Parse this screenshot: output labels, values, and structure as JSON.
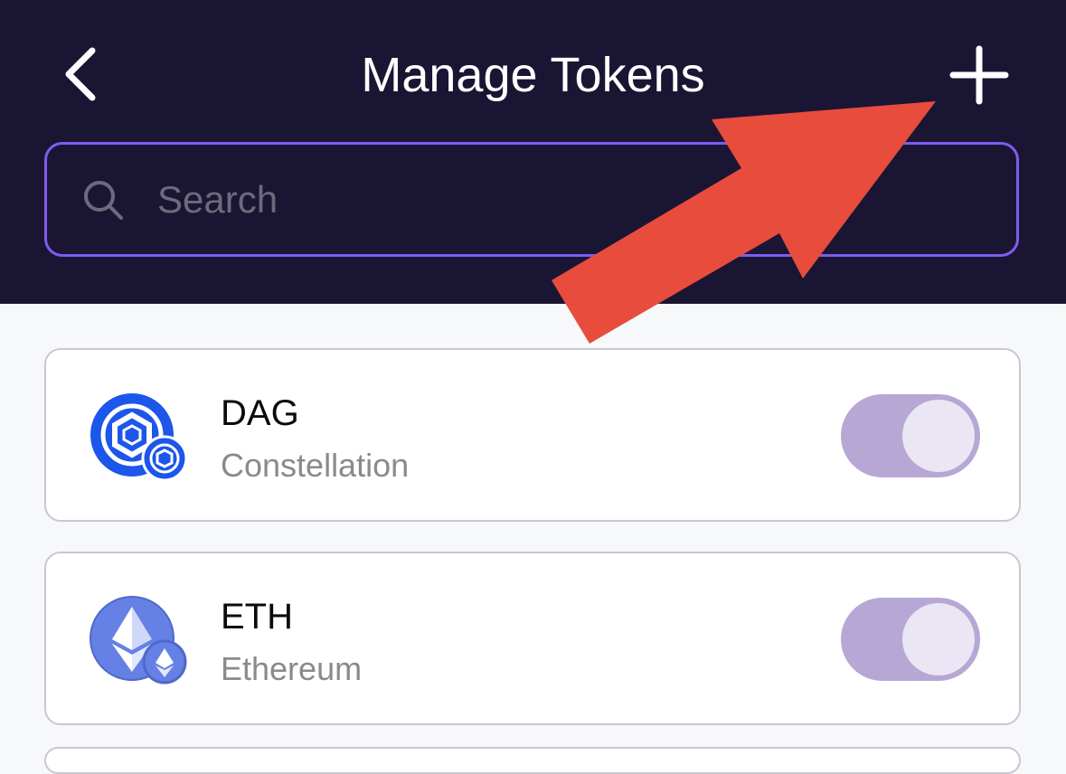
{
  "header": {
    "title": "Manage Tokens",
    "back_icon": "chevron-left-icon",
    "add_icon": "plus-icon"
  },
  "search": {
    "placeholder": "Search",
    "value": ""
  },
  "tokens": [
    {
      "symbol": "DAG",
      "name": "Constellation",
      "enabled": true,
      "icon": "constellation-icon"
    },
    {
      "symbol": "ETH",
      "name": "Ethereum",
      "enabled": true,
      "icon": "ethereum-icon"
    }
  ],
  "colors": {
    "header_bg": "#1b1534",
    "search_border": "#7e5cef",
    "toggle_on": "#b7a7d5",
    "annotation_arrow": "#e84c3d"
  }
}
